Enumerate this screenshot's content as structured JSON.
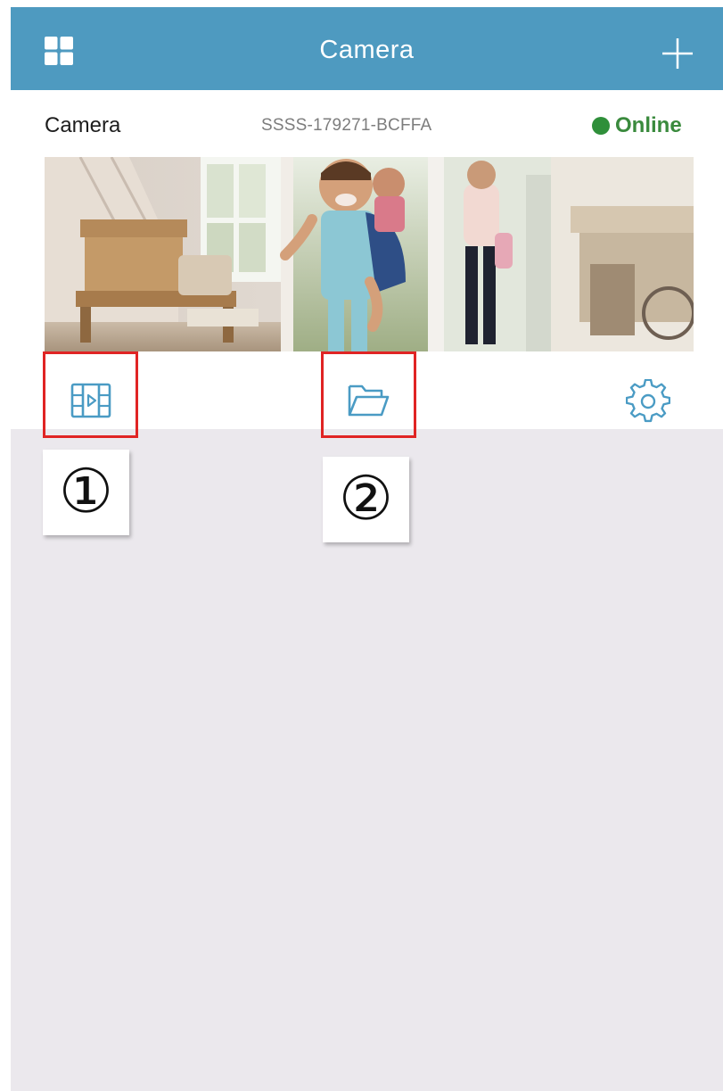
{
  "app_bar": {
    "title": "Camera",
    "left_icon": "grid-icon",
    "right_icon": "plus-icon"
  },
  "camera_card": {
    "name": "Camera",
    "uid": "SSSS-179271-BCFFA",
    "status": "Online",
    "status_color": "#2f8f3a",
    "preview_alt": "camera-preview",
    "actions": [
      {
        "icon": "video-playback-icon"
      },
      {
        "icon": "folder-icon"
      },
      {
        "icon": "gear-icon"
      }
    ]
  },
  "annotations": {
    "step1": "①",
    "step2": "②",
    "highlight_color": "#e02424"
  },
  "colors": {
    "app_bar": "#4e9ac0",
    "background": "#ebe8ed",
    "icon": "#4a9bc4"
  }
}
